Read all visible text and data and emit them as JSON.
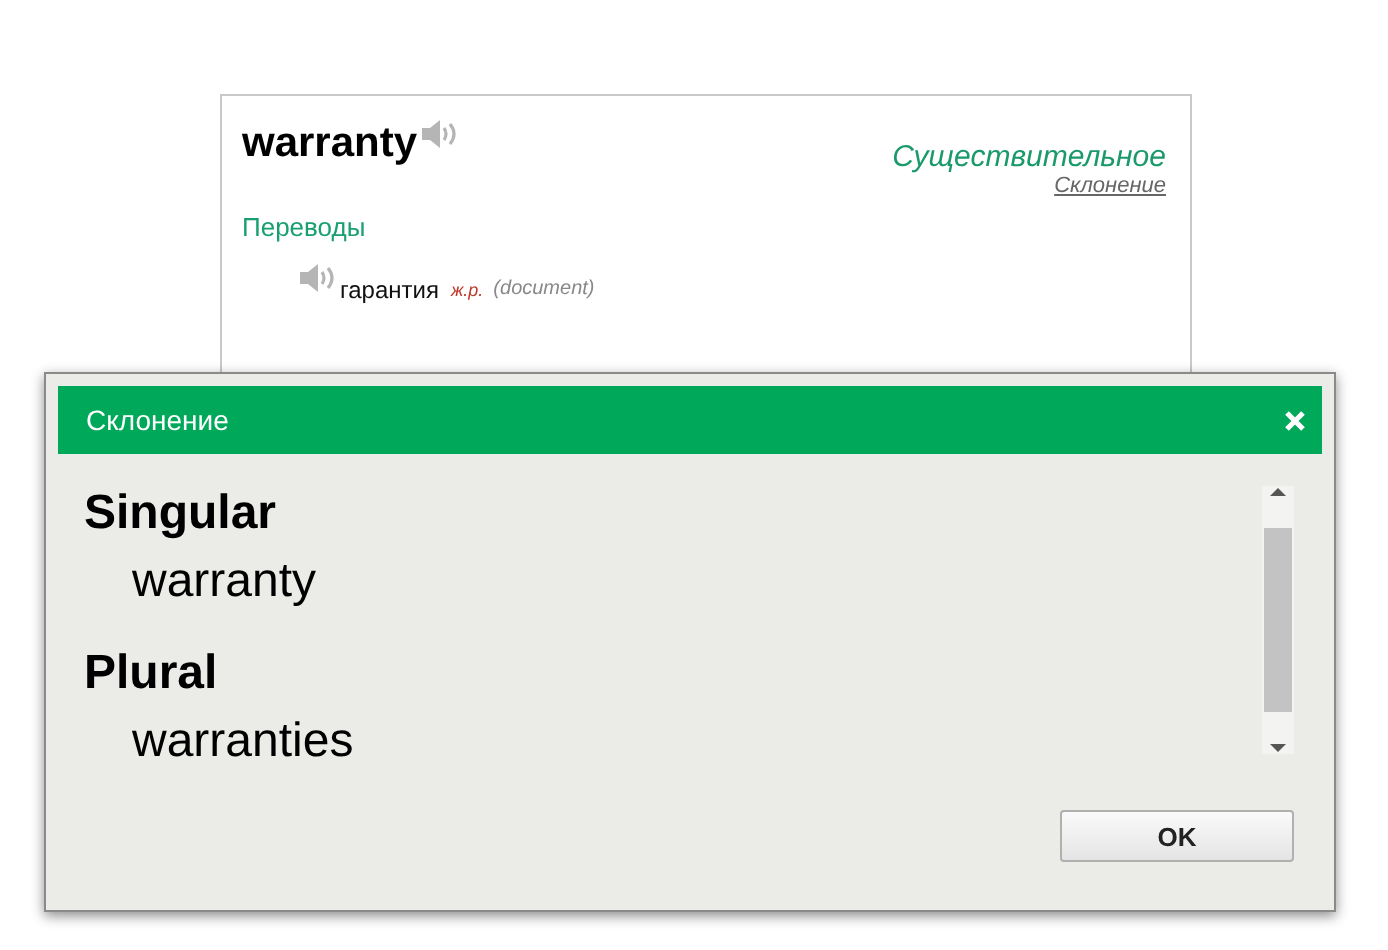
{
  "entry": {
    "word": "warranty",
    "part_of_speech": "Существительное",
    "declension_link": "Склонение",
    "section_title": "Переводы",
    "translations": [
      {
        "word": "гарантия",
        "gender": "ж.р.",
        "context": "(document)"
      }
    ]
  },
  "dialog": {
    "title": "Склонение",
    "forms": [
      {
        "label": "Singular",
        "value": "warranty"
      },
      {
        "label": "Plural",
        "value": "warranties"
      }
    ],
    "buttons": [
      "OK"
    ]
  }
}
